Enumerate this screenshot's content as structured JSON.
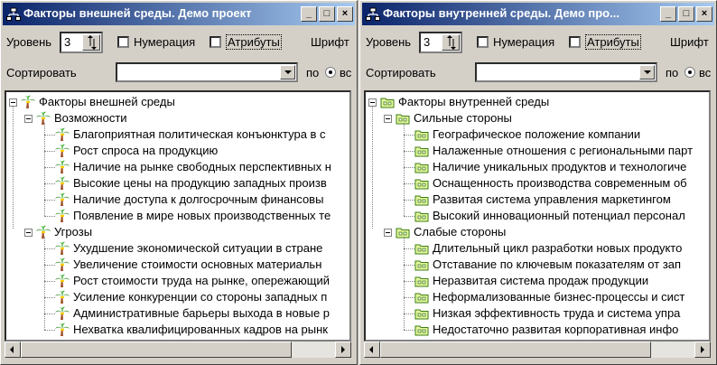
{
  "windows": [
    {
      "title": "Факторы внешней среды. Демо проект",
      "level_label": "Уровень",
      "level_value": "3",
      "numbering_label": "Нумерация",
      "attributes_label": "Атрибуты",
      "font_label": "Шрифт",
      "sort_label": "Сортировать",
      "sort_value": "",
      "order_label": "по",
      "order_value_label": "вс",
      "tree": {
        "root": "Факторы внешней среды",
        "groups": [
          {
            "label": "Возможности",
            "items": [
              "Благоприятная политическая конъюнктура в с",
              "Рост спроса на продукцию",
              "Наличие на рынке свободных перспективных н",
              "Высокие цены на продукцию западных произв",
              "Наличие доступа к долгосрочным финансовы",
              "Появление в мире новых производственных те"
            ]
          },
          {
            "label": "Угрозы",
            "items": [
              "Ухудшение экономической ситуации в стране",
              "Увеличение стоимости основных материальн",
              "Рост стоимости труда на рынке, опережающий",
              "Усиление конкуренции со стороны западных п",
              "Административные барьеры выхода в новые р",
              "Нехватка квалифицированных кадров на рынк"
            ]
          }
        ]
      }
    },
    {
      "title": "Факторы внутренней среды. Демо про...",
      "level_label": "Уровень",
      "level_value": "3",
      "numbering_label": "Нумерация",
      "attributes_label": "Атрибуты",
      "font_label": "Шрифт",
      "sort_label": "Сортировать",
      "sort_value": "",
      "order_label": "по",
      "order_value_label": "вс",
      "tree": {
        "root": "Факторы внутренней среды",
        "groups": [
          {
            "label": "Сильные стороны",
            "items": [
              "Географическое положение компании",
              "Налаженные отношения с региональными парт",
              "Наличие уникальных продуктов и технологиче",
              "Оснащенность производства современным об",
              "Развитая система управления маркетингом",
              "Высокий инновационный потенциал персонал"
            ]
          },
          {
            "label": "Слабые стороны",
            "items": [
              "Длительный цикл разработки новых продукто",
              "Отставание по ключевым показателям от зап",
              "Неразвитая система продаж продукции",
              "Неформализованные бизнес-процессы и сист",
              "Низкая эффективность труда и система упра",
              "Недостаточно развитая корпоративная инфо"
            ]
          }
        ]
      }
    }
  ],
  "icons": {
    "title": "hierarchy-icon",
    "external_tree_node": "palm-tree-icon",
    "internal_tree_node": "green-folder-icon"
  },
  "colors": {
    "titlebar_start": "#0a246a",
    "titlebar_end": "#a6caf0",
    "face": "#d4d0c8"
  }
}
